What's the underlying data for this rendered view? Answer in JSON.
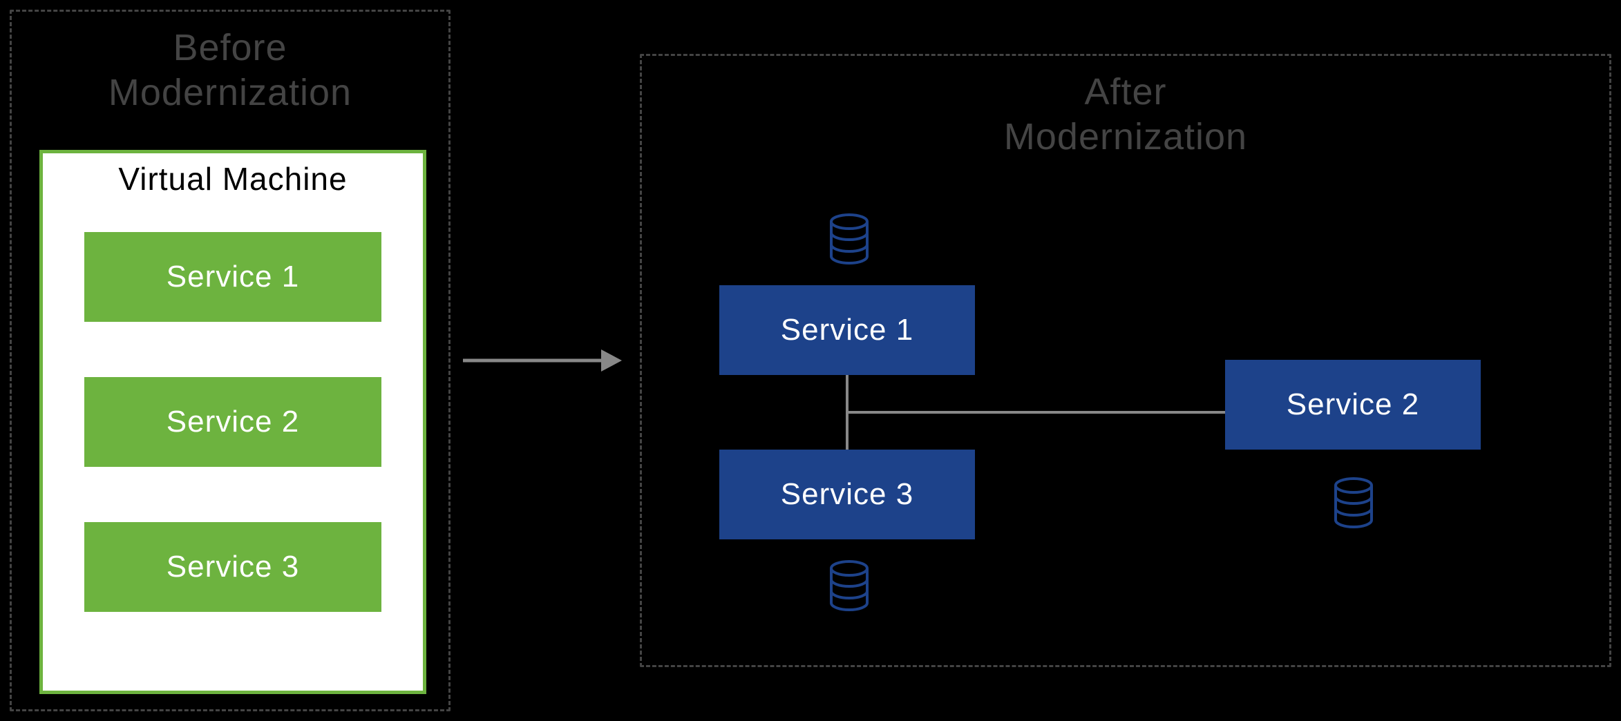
{
  "before": {
    "title_line1": "Before",
    "title_line2": "Modernization",
    "vm_title": "Virtual Machine",
    "services": [
      "Service 1",
      "Service 2",
      "Service 3"
    ]
  },
  "after": {
    "title_line1": "After",
    "title_line2": "Modernization",
    "service1": "Service 1",
    "service2": "Service 2",
    "service3": "Service 3"
  },
  "colors": {
    "green": "#6db33f",
    "blue": "#1d428a",
    "dash": "#444444",
    "arrow": "#888888",
    "dbStroke": "#1d428a"
  }
}
